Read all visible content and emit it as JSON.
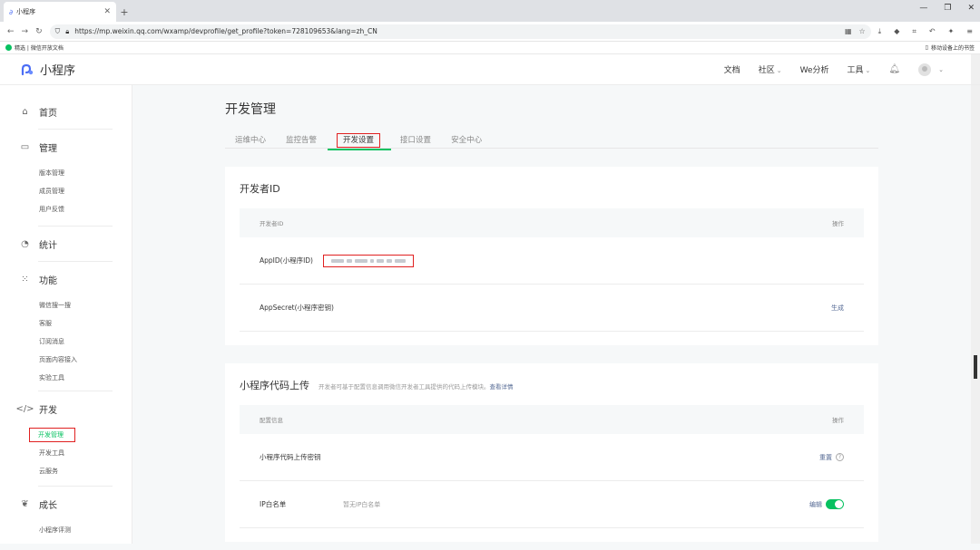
{
  "browser": {
    "tab_title": "小程序",
    "url": "https://mp.weixin.qq.com/wxamp/devprofile/get_profile?token=728109653&lang=zh_CN",
    "bookmarks_left": "精选 | 微信开放文档",
    "bookmarks_right": "移动设备上的书签"
  },
  "header": {
    "app_name": "小程序",
    "nav": [
      "文档",
      "社区",
      "We分析",
      "工具"
    ]
  },
  "sidebar": {
    "groups": [
      {
        "label": "首页",
        "icon": "home-icon",
        "items": []
      },
      {
        "label": "管理",
        "icon": "manage-icon",
        "items": [
          "版本管理",
          "成员管理",
          "用户反馈"
        ]
      },
      {
        "label": "统计",
        "icon": "stats-icon",
        "items": []
      },
      {
        "label": "功能",
        "icon": "feature-icon",
        "items": [
          "微信搜一搜",
          "客服",
          "订阅消息",
          "页面内容接入",
          "实验工具"
        ]
      },
      {
        "label": "开发",
        "icon": "code-icon",
        "items": [
          "开发管理",
          "开发工具",
          "云服务"
        ]
      },
      {
        "label": "成长",
        "icon": "growth-icon",
        "items": [
          "小程序评测"
        ]
      }
    ]
  },
  "page": {
    "title": "开发管理",
    "tabs": [
      "运维中心",
      "监控告警",
      "开发设置",
      "接口设置",
      "安全中心"
    ],
    "active_tab": "开发设置"
  },
  "dev_id_card": {
    "title": "开发者ID",
    "col_name": "开发者ID",
    "col_op": "操作",
    "rows": [
      {
        "label": "AppID(小程序ID)",
        "op": ""
      },
      {
        "label": "AppSecret(小程序密钥)",
        "op": "生成"
      }
    ]
  },
  "upload_card": {
    "title": "小程序代码上传",
    "desc": "开发者可基于配置信息调用微信开发者工具提供的代码上传模块。",
    "desc_link": "查看详情",
    "col_name": "配置信息",
    "col_op": "操作",
    "rows": [
      {
        "label": "小程序代码上传密钥",
        "value": "",
        "op": "重置"
      },
      {
        "label": "IP白名单",
        "value": "暂无IP白名单",
        "op": "编辑"
      }
    ]
  },
  "colors": {
    "accent": "#07c160",
    "link": "#576b95",
    "highlight": "#e02020"
  }
}
